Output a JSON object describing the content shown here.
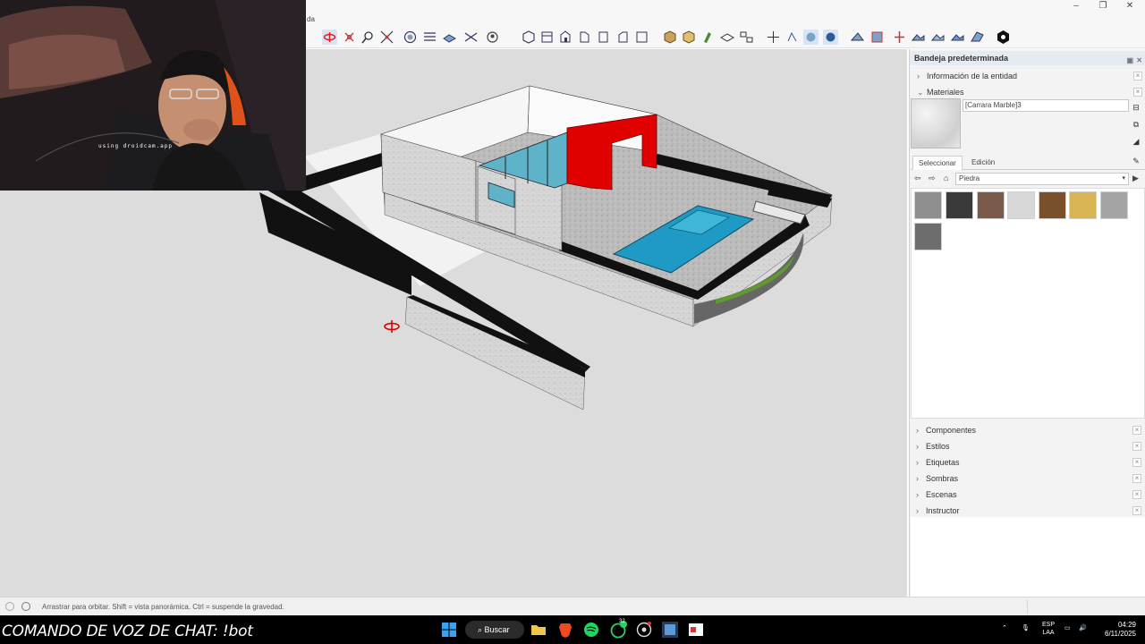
{
  "window": {
    "menu_fragment": "da",
    "controls": {
      "minimize": "–",
      "maximize": "❐",
      "close": "✕"
    }
  },
  "toolbar": {
    "icons": [
      "orbit-icon",
      "pan-icon",
      "zoom-icon",
      "zoom-extents-icon",
      "xray-icon",
      "back-edges-icon",
      "wireframe-icon",
      "hidden-line-icon",
      "shaded-icon",
      "iso-view-icon",
      "top-view-icon",
      "front-view-icon",
      "right-view-icon",
      "back-view-icon",
      "left-view-icon",
      "box-icon",
      "component-icon",
      "paint-icon",
      "section-plane-icon",
      "section-display-icon",
      "position-camera-icon",
      "walk-icon",
      "look-around-icon",
      "sandbox-icon",
      "extension-icon",
      "warehouse-icon"
    ]
  },
  "webcam": {
    "overlay_text": "using droidcam.app"
  },
  "tray": {
    "title": "Bandeja predeterminada",
    "sections_top": [
      {
        "label": "Información de la entidad",
        "expanded": false
      },
      {
        "label": "Materiales",
        "expanded": true
      }
    ],
    "material": {
      "name": "[Carrara Marble]3",
      "tabs": [
        "Seleccionar",
        "Edición"
      ],
      "active_tab": "Seleccionar",
      "library": "Piedra",
      "swatch_colors": [
        "#8f8f8f",
        "#3a3a3a",
        "#7a5a4a",
        "#d8d8d8",
        "#7a4f2b",
        "#d8b455",
        "#a4a4a4",
        "#6d6d6d"
      ]
    },
    "sections_bottom": [
      "Componentes",
      "Estilos",
      "Etiquetas",
      "Sombras",
      "Escenas",
      "Instructor"
    ]
  },
  "status": {
    "hint": "Arrastrar para orbitar. Shift = vista panorámica. Ctrl = suspende la gravedad."
  },
  "taskbar": {
    "chat_command": "COMANDO DE VOZ DE CHAT: !bot",
    "search_label": "Buscar",
    "lang_top": "ESP",
    "lang_bottom": "LAA",
    "time": "04:29",
    "date": "6/11/2025",
    "whatsapp_badge": "32"
  }
}
